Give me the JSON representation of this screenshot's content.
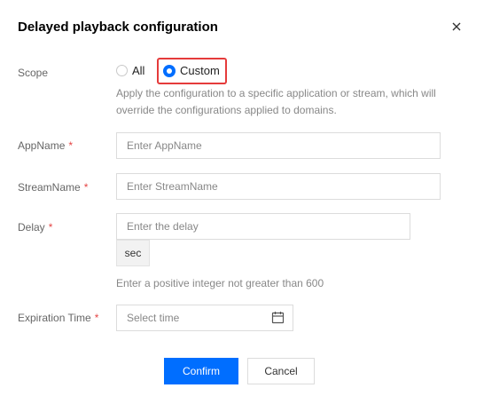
{
  "dialog": {
    "title": "Delayed playback configuration",
    "close_icon": "close-icon"
  },
  "scope": {
    "label": "Scope",
    "options": [
      {
        "label": "All",
        "selected": false
      },
      {
        "label": "Custom",
        "selected": true
      }
    ],
    "help_line1": "Apply the configuration to a specific application or stream, which will",
    "help_line2": "override the configurations applied to domains."
  },
  "app_name": {
    "label": "AppName",
    "required_mark": "*",
    "placeholder": "Enter AppName",
    "value": ""
  },
  "stream_name": {
    "label": "StreamName",
    "required_mark": "*",
    "placeholder": "Enter StreamName",
    "value": ""
  },
  "delay": {
    "label": "Delay",
    "required_mark": "*",
    "placeholder": "Enter the delay",
    "value": "",
    "unit": "sec",
    "help": "Enter a positive integer not greater than 600"
  },
  "expiration": {
    "label": "Expiration Time",
    "required_mark": "*",
    "placeholder": "Select time",
    "icon": "calendar-icon"
  },
  "buttons": {
    "confirm": "Confirm",
    "cancel": "Cancel"
  },
  "colors": {
    "primary": "#006eff",
    "required": "#e54545",
    "highlight": "#e53b3b"
  }
}
